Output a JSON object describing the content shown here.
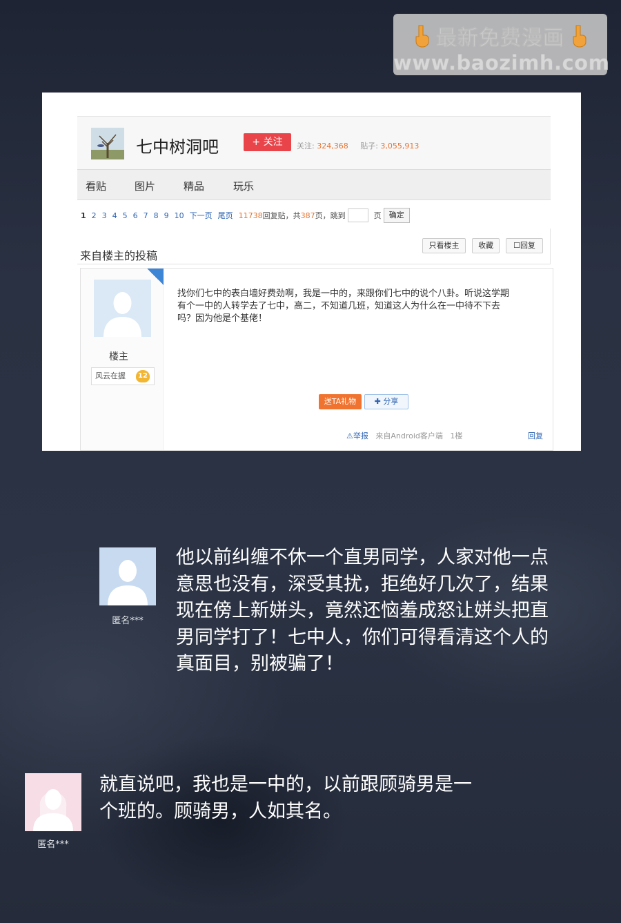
{
  "watermark": {
    "title": "最新免费漫画",
    "url": "www.baozimh.com",
    "hand_icon": "pointing-down-hand"
  },
  "forum": {
    "name": "七中树洞吧",
    "follow_label": "+ 关注",
    "follow_count_label": "关注:",
    "follow_count": "324,368",
    "posts_label": "贴子:",
    "posts_count": "3,055,913",
    "nav": [
      "看贴",
      "图片",
      "精品",
      "玩乐"
    ]
  },
  "pager": {
    "pages": [
      "1",
      "2",
      "3",
      "4",
      "5",
      "6",
      "7",
      "8",
      "9",
      "10"
    ],
    "next": "下一页",
    "last": "尾页",
    "replies": "11738",
    "replies_label": "回复贴，共",
    "total_pages": "387",
    "pages_label": "页，",
    "jump_label": "跳到",
    "page_unit": "页",
    "confirm": "确定"
  },
  "thread": {
    "title": "来自楼主的投稿",
    "only_op": "只看楼主",
    "favorite": "收藏",
    "reply": "回复"
  },
  "post": {
    "author": "楼主",
    "corner_tag": "楼主",
    "rank": "风云在握",
    "level": "12",
    "body": "找你们七中的表白墙好费劲啊，我是一中的，来跟你们七中的说个八卦。听说这学期有个一中的人转学去了七中，高二，不知道几班，知道这人为什么在一中待不下去吗？因为他是个基佬！",
    "gift": "送TA礼物",
    "share": "分享",
    "report": "举报",
    "source": "来自Android客户端",
    "floor": "1楼",
    "reply": "回复"
  },
  "comments": [
    {
      "name": "匿名***",
      "text": "他以前纠缠不休一个直男同学，人家对他一点意思也没有，深受其扰，拒绝好几次了，结果现在傍上新姘头，竟然还恼羞成怒让姘头把直男同学打了！七中人，你们可得看清这个人的真面目，别被骗了！"
    },
    {
      "name": "匿名***",
      "text": "就直说吧，我也是一中的，以前跟顾骑男是一个班的。顾骑男，人如其名。"
    }
  ]
}
